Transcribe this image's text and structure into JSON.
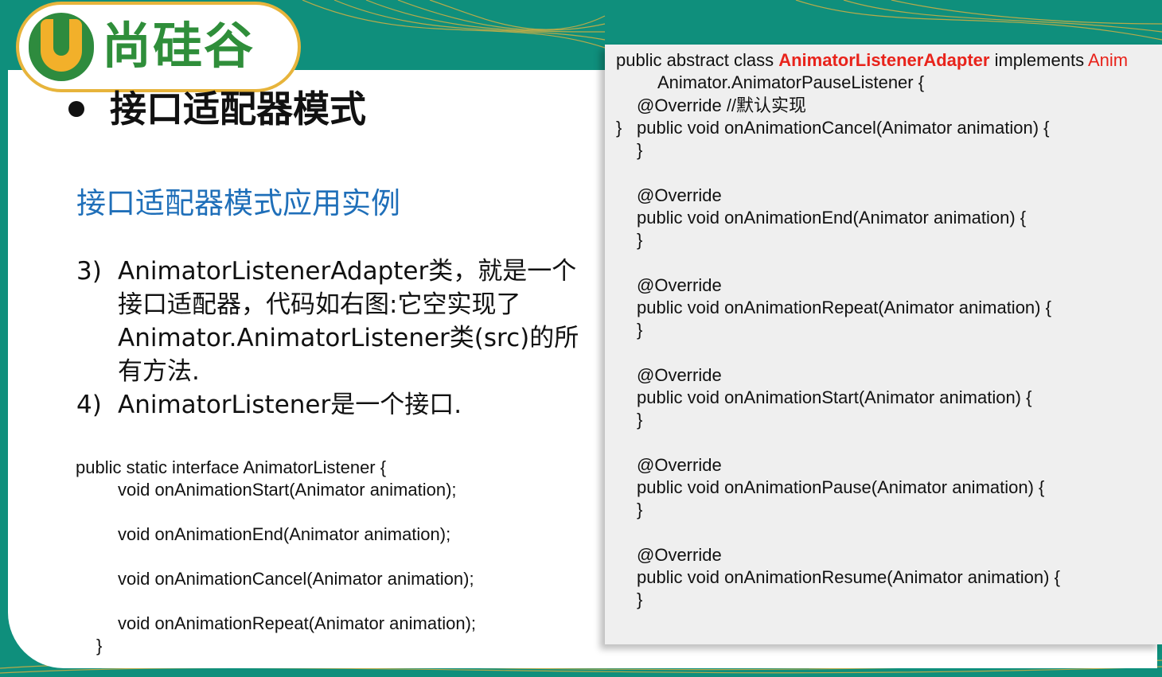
{
  "logo": {
    "text": "尚硅谷"
  },
  "title": "接口适配器模式",
  "subtitle": "接口适配器模式应用实例",
  "points": [
    {
      "num": "3)",
      "text": "AnimatorListenerAdapter类，就是一个接口适配器，代码如右图:它空实现了Animator.AnimatorListener类(src)的所有方法."
    },
    {
      "num": "4)",
      "text": "AnimatorListener是一个接口."
    }
  ],
  "code_left": [
    "public static interface AnimatorListener {",
    "void onAnimationStart(Animator animation);",
    "",
    "void onAnimationEnd(Animator animation);",
    "",
    "void onAnimationCancel(Animator animation);",
    "",
    "void onAnimationRepeat(Animator animation);",
    "}"
  ],
  "code_right": {
    "decl_prefix": "public abstract class ",
    "class_name": "AnimatorListenerAdapter",
    "decl_middle": " implements ",
    "decl_cut": "Anim",
    "line2": "Animator.AnimatorPauseListener {",
    "override": "@Override",
    "comment": " //默认实现",
    "methods": [
      "public void onAnimationCancel(Animator animation) {",
      "public void onAnimationEnd(Animator animation) {",
      "public void onAnimationRepeat(Animator animation) {",
      "public void onAnimationStart(Animator animation) {",
      "public void onAnimationPause(Animator animation) {",
      "public void onAnimationResume(Animator animation) {"
    ],
    "close_brace": "}"
  },
  "colors": {
    "accent": "#e8231b",
    "subtitle": "#1f6fb9",
    "background": "#0f8f7c",
    "logo_green": "#2f8e3a"
  }
}
